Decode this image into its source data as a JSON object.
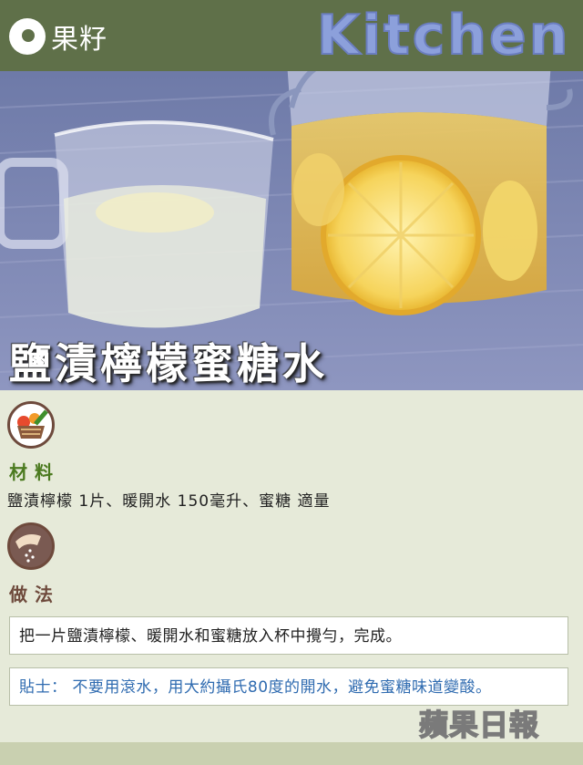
{
  "header": {
    "brand_name": "果籽",
    "kitchen_label": "Kitchen"
  },
  "hero": {
    "title": "鹽漬檸檬蜜糖水"
  },
  "ingredients": {
    "heading": "材料",
    "text": "鹽漬檸檬 1片、暖開水 150毫升、蜜糖 適量",
    "icon": "vegetable-basket-icon"
  },
  "method": {
    "heading": "做法",
    "step": "把一片鹽漬檸檬、暖開水和蜜糖放入杯中攪勻，完成。",
    "tip": "貼士： 不要用滾水，用大約攝氏80度的開水，避免蜜糖味道變酸。",
    "icon": "sprinkling-hand-icon"
  },
  "footer": {
    "logo_text": "蘋果日報"
  },
  "colors": {
    "header_green": "#5f7049",
    "ingredients_green": "#4b7a1f",
    "method_brown": "#6e4a3c",
    "tip_blue": "#2f6bb0",
    "background": "#e6ead9"
  }
}
